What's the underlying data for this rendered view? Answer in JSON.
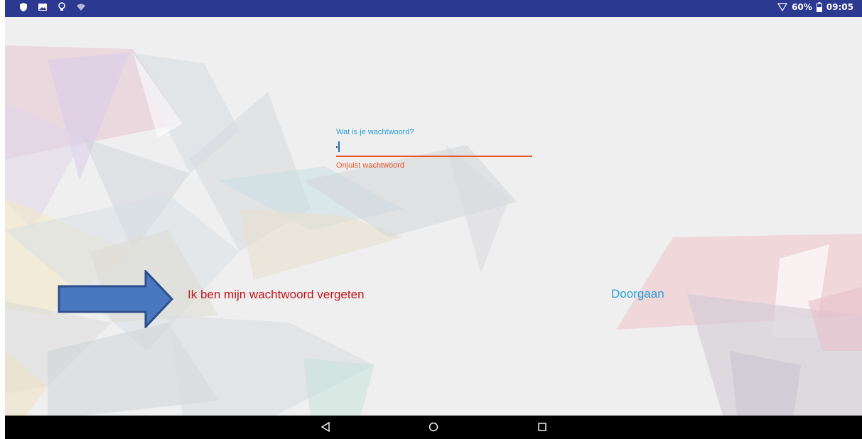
{
  "status_bar": {
    "battery": "60%",
    "time": "09:05",
    "left_icons": [
      "shield-icon",
      "image-icon",
      "lightbulb-icon",
      "wifi-icon"
    ],
    "right_icons": [
      "signal-icon",
      "battery-icon"
    ]
  },
  "login": {
    "password_label": "Wat is je wachtwoord?",
    "password_value": "",
    "error_text": "Onjuist wachtwoord",
    "forgot_label": "Ik ben mijn wachtwoord vergeten",
    "continue_label": "Doorgaan"
  },
  "nav_bar": {
    "icons": [
      "back-icon",
      "home-icon",
      "recents-icon"
    ]
  },
  "colors": {
    "status_bar": "#2b3990",
    "accent_blue": "#2a9fd6",
    "error_orange": "#e8582a",
    "forgot_red": "#c0151b",
    "arrow_fill": "#4a78c0",
    "arrow_stroke": "#2c4f8c"
  }
}
